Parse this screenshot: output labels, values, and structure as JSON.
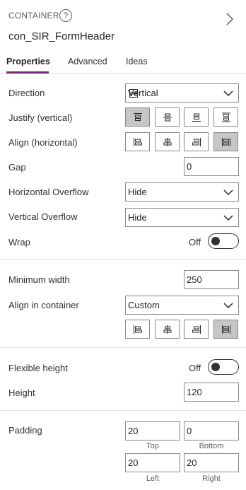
{
  "header": {
    "control_type": "CONTAINER",
    "help_glyph": "?",
    "control_name": "con_SIR_FormHeader"
  },
  "tabs": [
    {
      "label": "Properties",
      "active": true
    },
    {
      "label": "Advanced",
      "active": false
    },
    {
      "label": "Ideas",
      "active": false
    }
  ],
  "layout": {
    "direction": {
      "label": "Direction",
      "value": "Vertical"
    },
    "justify": {
      "label": "Justify (vertical)",
      "options": [
        "start",
        "center",
        "end",
        "space-between"
      ],
      "selected": "start"
    },
    "align": {
      "label": "Align (horizontal)",
      "options": [
        "start",
        "center",
        "end",
        "stretch"
      ],
      "selected": "stretch"
    },
    "gap": {
      "label": "Gap",
      "value": "0"
    },
    "horizontal_overflow": {
      "label": "Horizontal Overflow",
      "value": "Hide"
    },
    "vertical_overflow": {
      "label": "Vertical Overflow",
      "value": "Hide"
    },
    "wrap": {
      "label": "Wrap",
      "state_text": "Off",
      "on": false
    }
  },
  "sizing": {
    "min_width": {
      "label": "Minimum width",
      "value": "250"
    },
    "align_in_container": {
      "label": "Align in container",
      "value": "Custom",
      "options": [
        "start",
        "center",
        "end",
        "stretch"
      ],
      "selected": "stretch"
    }
  },
  "height": {
    "flexible": {
      "label": "Flexible height",
      "state_text": "Off",
      "on": false
    },
    "height": {
      "label": "Height",
      "value": "120"
    }
  },
  "padding": {
    "label": "Padding",
    "top": {
      "value": "20",
      "caption": "Top"
    },
    "bottom": {
      "value": "0",
      "caption": "Bottom"
    },
    "left": {
      "value": "20",
      "caption": "Left"
    },
    "right": {
      "value": "20",
      "caption": "Right"
    }
  },
  "colors": {
    "accent": "#742774",
    "selected_button": "#c8c6c4",
    "border": "#8a8886",
    "divider": "#e1dfdd"
  }
}
